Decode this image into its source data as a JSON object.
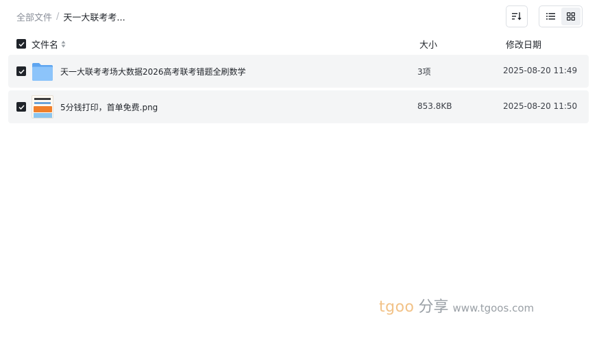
{
  "breadcrumb": {
    "root": "全部文件",
    "separator": "/",
    "current": "天一大联考考..."
  },
  "toolbar": {
    "sort_icon": "sort-icon",
    "list_icon": "list-view-icon",
    "grid_icon": "grid-view-icon"
  },
  "table": {
    "headers": {
      "name": "文件名",
      "size": "大小",
      "date": "修改日期"
    },
    "rows": [
      {
        "icon": "folder-icon",
        "name": "天一大联考考场大数据2026高考联考错题全刷数学",
        "size": "3项",
        "date": "2025-08-20 11:49",
        "checked": true
      },
      {
        "icon": "image-thumbnail",
        "name": "5分钱打印，首单免费.png",
        "size": "853.8KB",
        "date": "2025-08-20 11:50",
        "checked": true
      }
    ]
  },
  "watermark": {
    "brand": "tgoo",
    "cn": "分享",
    "url": "www.tgoos.com"
  },
  "colors": {
    "row_bg": "#f4f5f6",
    "checkbox": "#1f2329",
    "folder": "#6fb1f5",
    "watermark_brand": "#f2c287"
  }
}
